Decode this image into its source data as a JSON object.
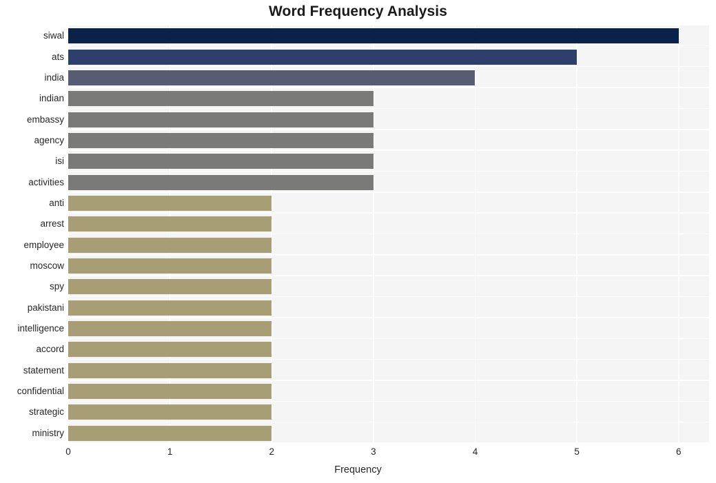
{
  "chart_data": {
    "type": "bar",
    "orientation": "horizontal",
    "title": "Word Frequency Analysis",
    "xlabel": "Frequency",
    "ylabel": "",
    "xlim": [
      0,
      6.3
    ],
    "xticks": [
      0,
      1,
      2,
      3,
      4,
      5,
      6
    ],
    "xtick_labels": [
      "0",
      "1",
      "2",
      "3",
      "4",
      "5",
      "6"
    ],
    "grid": true,
    "legend": null,
    "categories": [
      "siwal",
      "ats",
      "india",
      "indian",
      "embassy",
      "agency",
      "isi",
      "activities",
      "anti",
      "arrest",
      "employee",
      "moscow",
      "spy",
      "pakistani",
      "intelligence",
      "accord",
      "statement",
      "confidential",
      "strategic",
      "ministry"
    ],
    "values": [
      6,
      5,
      4,
      3,
      3,
      3,
      3,
      3,
      2,
      2,
      2,
      2,
      2,
      2,
      2,
      2,
      2,
      2,
      2,
      2
    ],
    "bar_colors": [
      "#0a2149",
      "#2e3f6b",
      "#575c72",
      "#7a7a78",
      "#7a7a78",
      "#7a7a78",
      "#7a7a78",
      "#7a7a78",
      "#a89e75",
      "#a89e75",
      "#a89e75",
      "#a89e75",
      "#a89e75",
      "#a89e75",
      "#a89e75",
      "#a89e75",
      "#a89e75",
      "#a89e75",
      "#a89e75",
      "#a89e75"
    ],
    "plot_background": "#f5f5f5",
    "grid_color": "#ffffff",
    "figure_background": "#ffffff"
  }
}
